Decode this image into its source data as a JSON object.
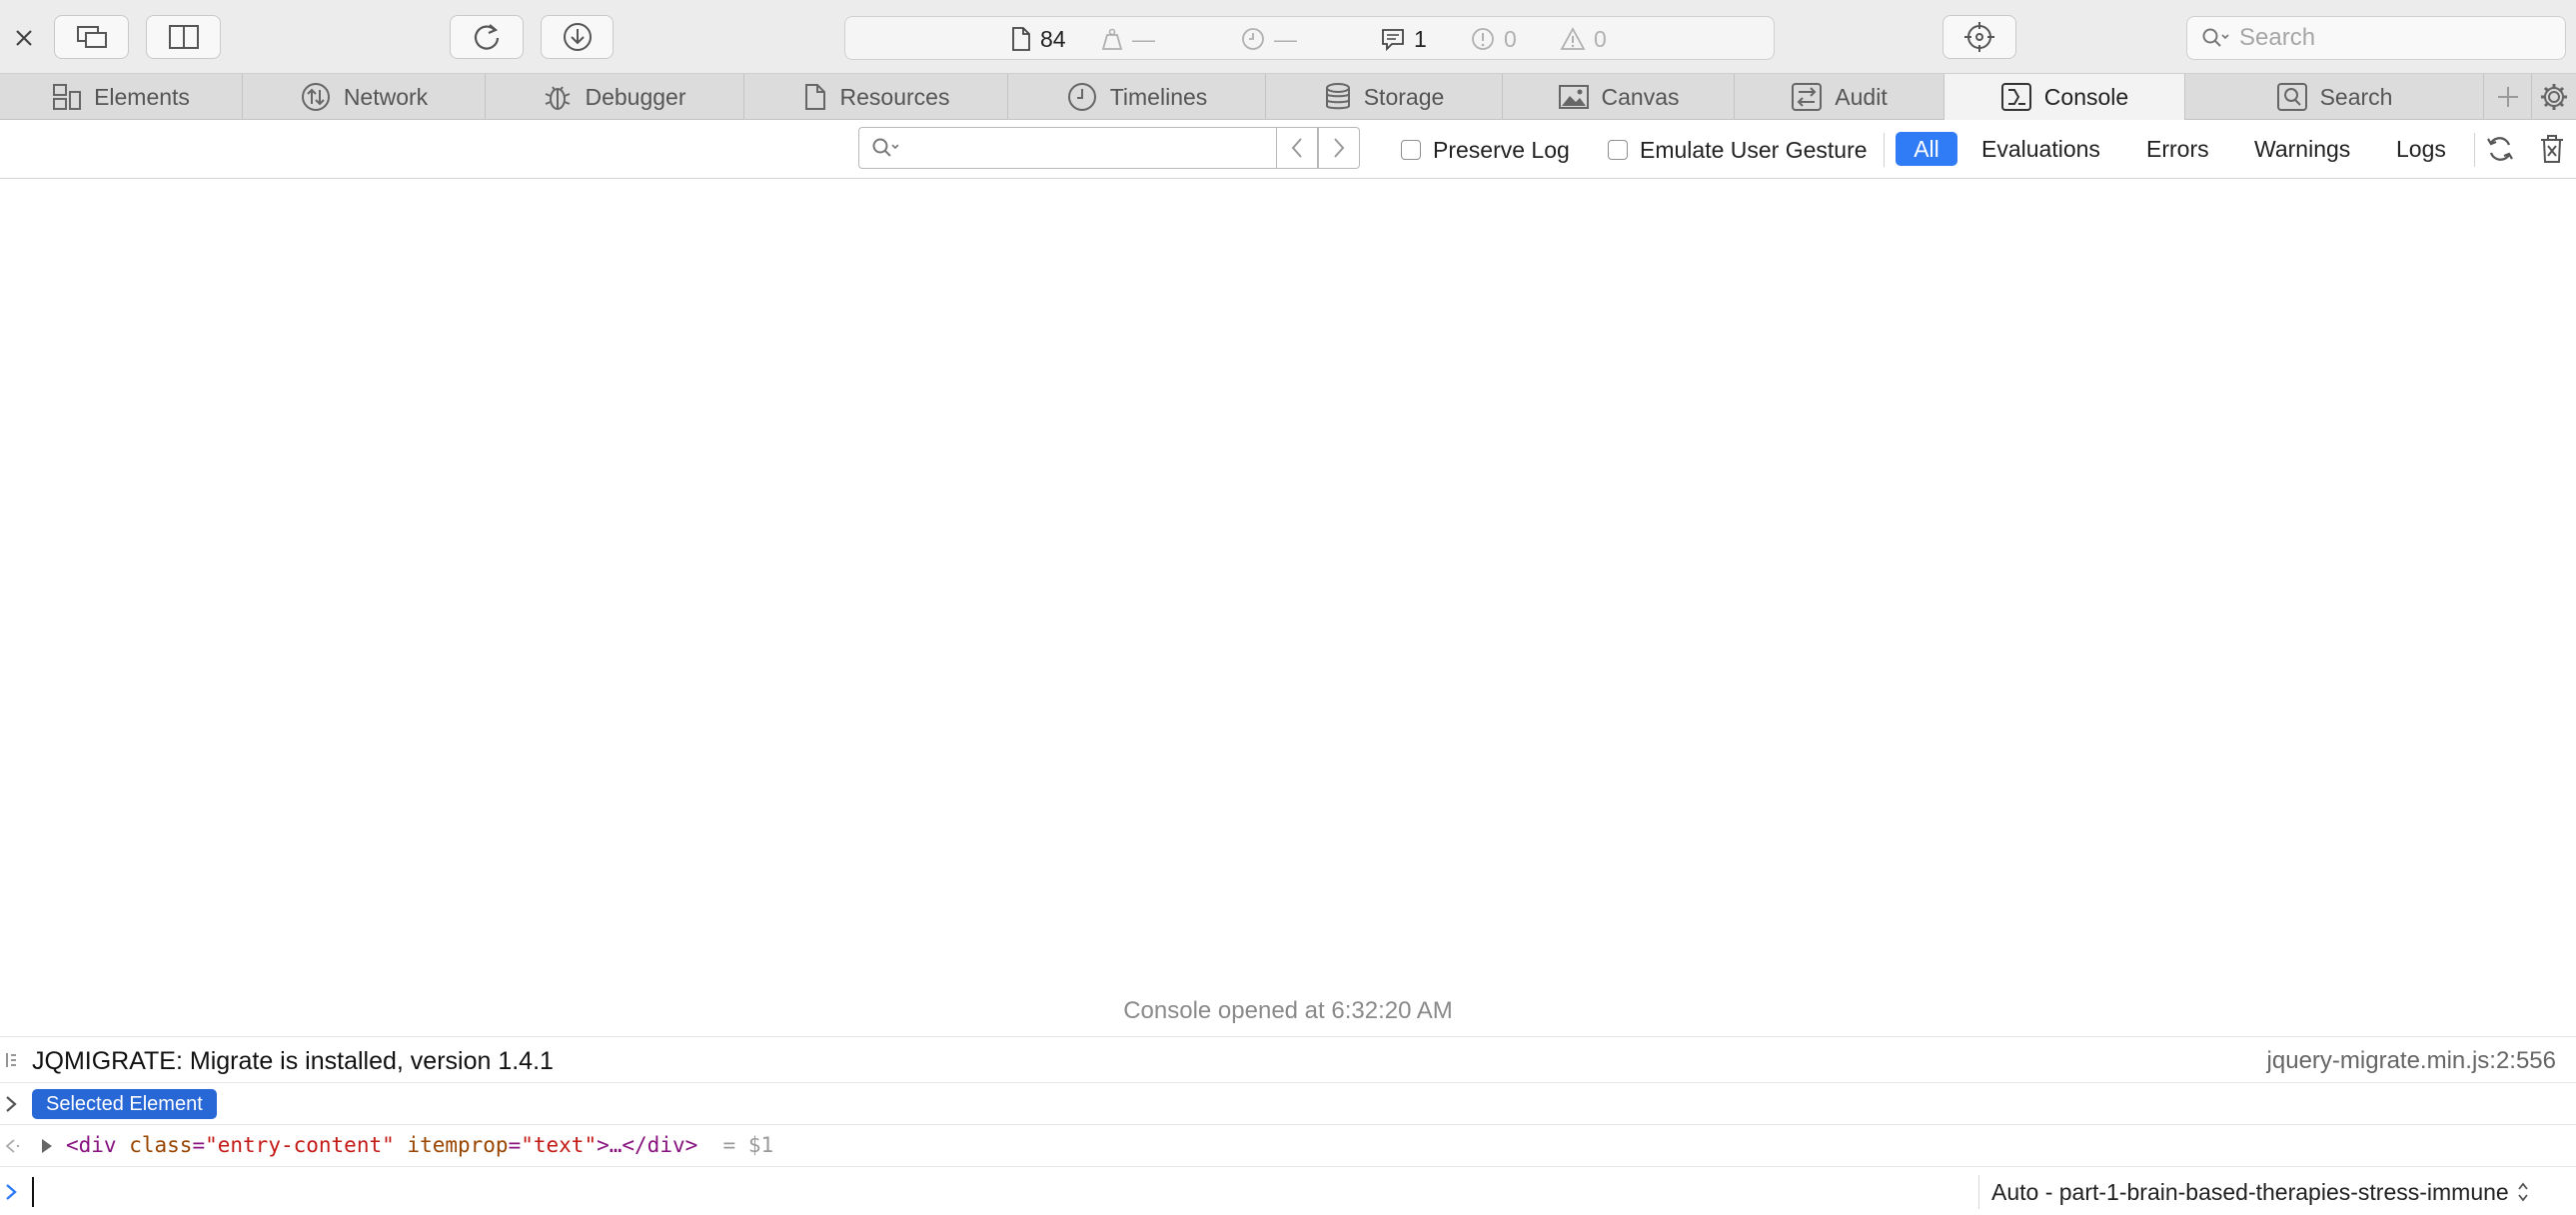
{
  "toolbar": {
    "activity": {
      "resources_count": "84",
      "load_size": "—",
      "load_time": "—",
      "logs_count": "1",
      "errors_count": "0",
      "warnings_count": "0"
    },
    "search_placeholder": "Search"
  },
  "tabs": [
    {
      "label": "Elements",
      "icon": "elements-icon"
    },
    {
      "label": "Network",
      "icon": "network-icon"
    },
    {
      "label": "Debugger",
      "icon": "debugger-icon"
    },
    {
      "label": "Resources",
      "icon": "resources-icon"
    },
    {
      "label": "Timelines",
      "icon": "timelines-icon"
    },
    {
      "label": "Storage",
      "icon": "storage-icon"
    },
    {
      "label": "Canvas",
      "icon": "canvas-icon"
    },
    {
      "label": "Audit",
      "icon": "audit-icon"
    },
    {
      "label": "Console",
      "icon": "console-icon",
      "active": true
    },
    {
      "label": "Search",
      "icon": "search-icon"
    }
  ],
  "filter": {
    "preserve_log": "Preserve Log",
    "emulate_gesture": "Emulate User Gesture",
    "levels": [
      "All",
      "Evaluations",
      "Errors",
      "Warnings",
      "Logs"
    ],
    "selected_level": "All"
  },
  "console": {
    "opened_text": "Console opened at 6:32:20 AM",
    "message": {
      "text": "JQMIGRATE: Migrate is installed, version 1.4.1",
      "location": "jquery-migrate.min.js:2:556"
    },
    "selected_badge": "Selected Element",
    "element": {
      "open_tag": "<div",
      "attr1_name": "class",
      "attr1_value": "\"entry-content\"",
      "attr2_name": "itemprop",
      "attr2_value": "\"text\"",
      "ellipsis": ">…",
      "close_tag": "</div>",
      "ref": "= $1"
    },
    "execution_context": "Auto - part-1-brain-based-therapies-stress-immune"
  },
  "colors": {
    "accent": "#2f7cf6",
    "badge": "#2767d6",
    "tag": "#881280",
    "attr_name": "#994500",
    "attr_value": "#c41a16"
  }
}
